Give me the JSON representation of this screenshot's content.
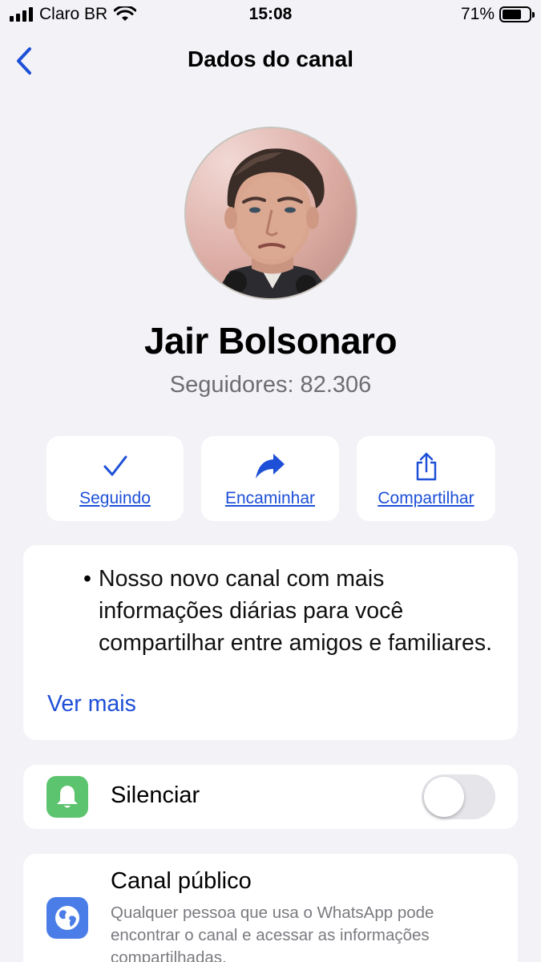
{
  "status_bar": {
    "carrier": "Claro BR",
    "time": "15:08",
    "battery_percent": "71%",
    "battery_level": 0.71
  },
  "nav": {
    "title": "Dados do canal"
  },
  "profile": {
    "name": "Jair Bolsonaro",
    "followers": "Seguidores: 82.306"
  },
  "actions": [
    {
      "label": "Seguindo",
      "icon": "checkmark-icon"
    },
    {
      "label": "Encaminhar",
      "icon": "forward-arrow-icon"
    },
    {
      "label": "Compartilhar",
      "icon": "share-icon"
    }
  ],
  "description": {
    "bullet": "•",
    "text": "Nosso novo canal com mais informações diárias para você compartilhar entre amigos e familiares.",
    "more_link": "Ver mais"
  },
  "mute": {
    "label": "Silenciar",
    "icon": "bell-icon",
    "enabled": false
  },
  "public_channel": {
    "title": "Canal público",
    "icon": "globe-icon",
    "description": "Qualquer pessoa que usa o WhatsApp pode encontrar o canal e acessar as informações compartilhadas."
  },
  "colors": {
    "background": "#f2f2f7",
    "accent_blue": "#1d4fd7",
    "bell_green": "#5cc46e",
    "globe_blue": "#4a7de8",
    "secondary_text": "#6d6d72"
  }
}
